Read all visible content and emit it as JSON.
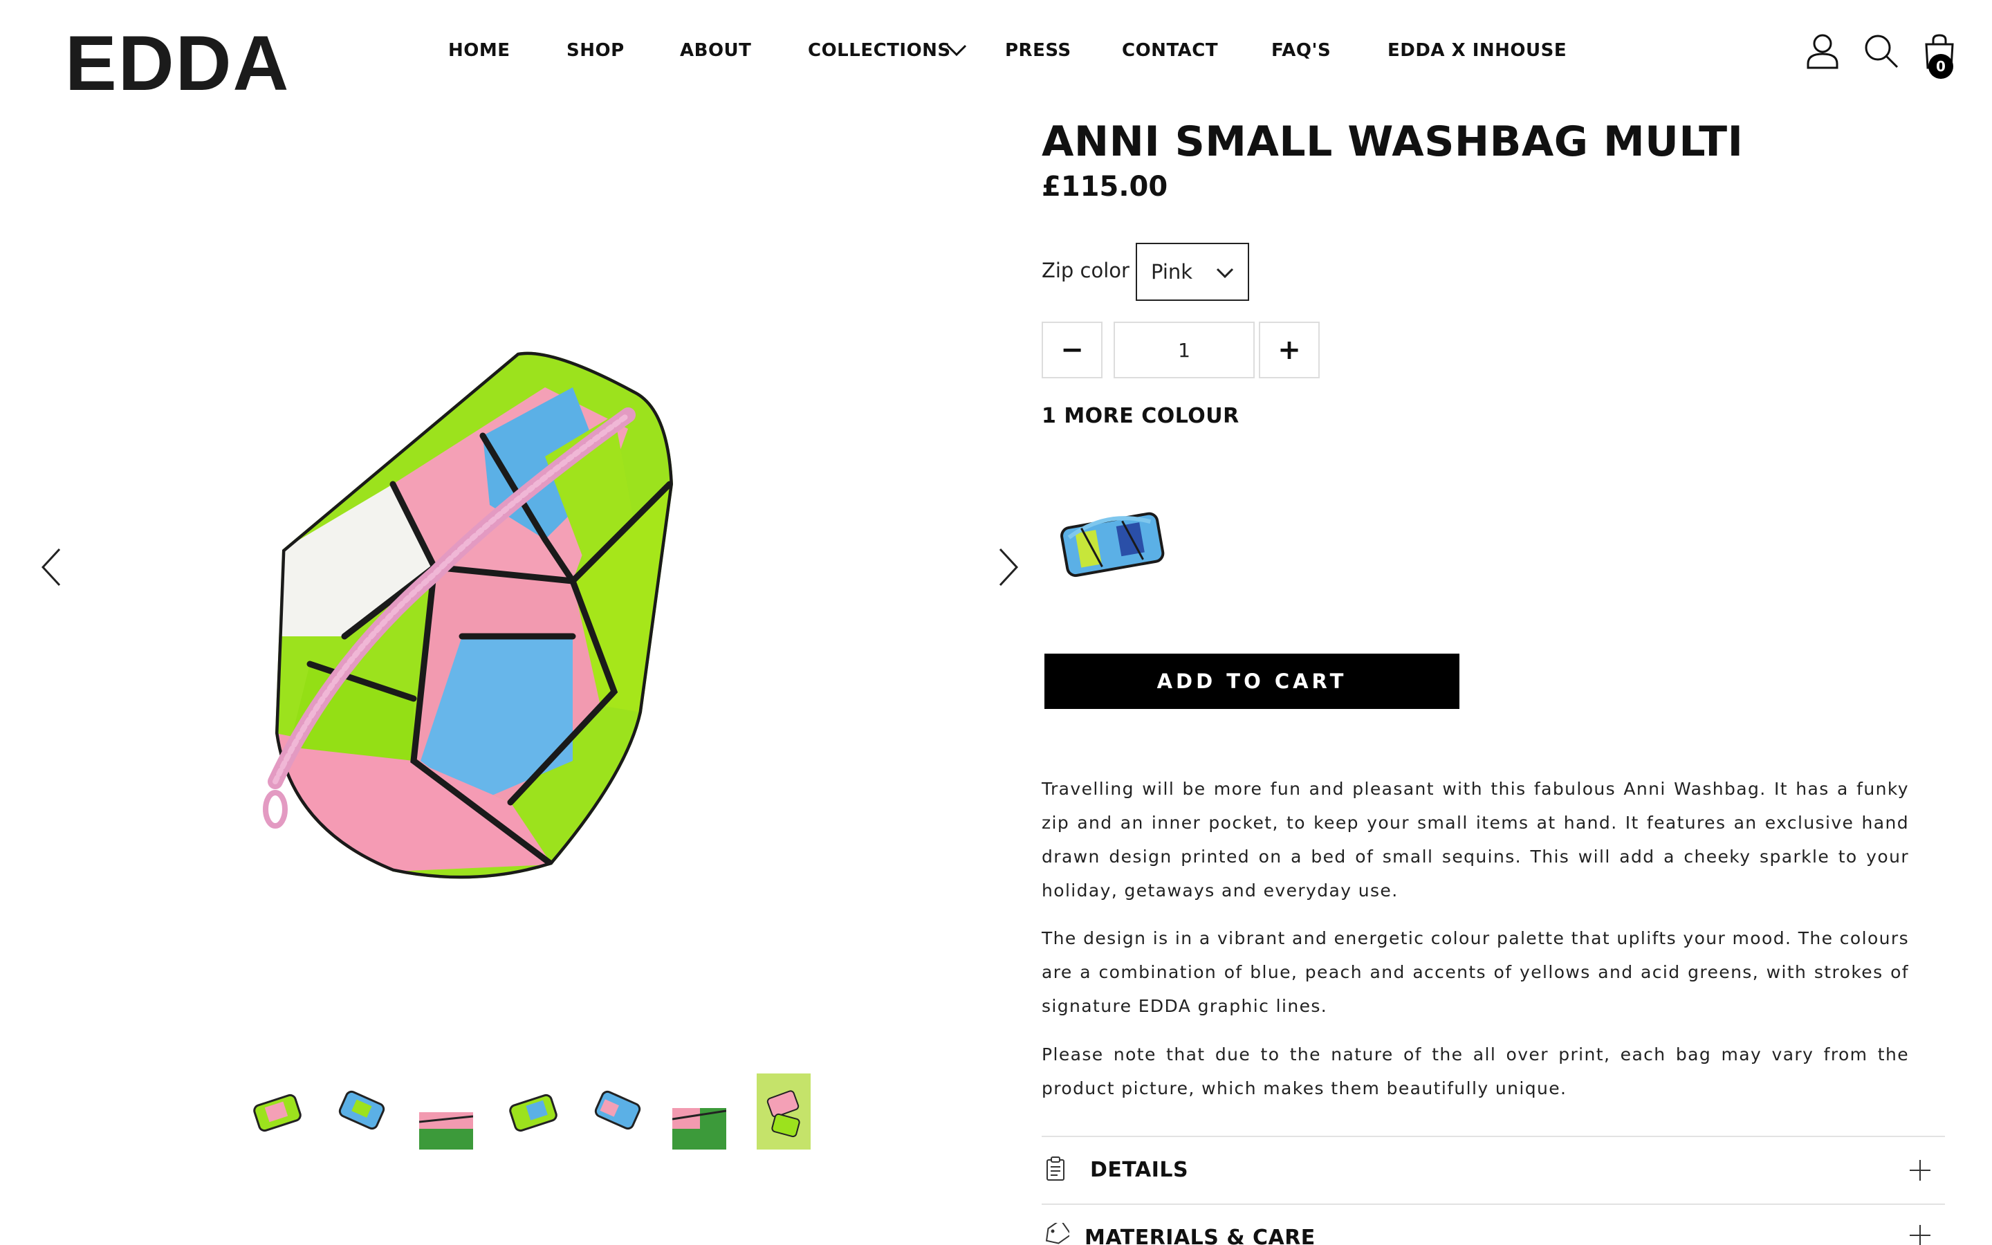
{
  "brand": {
    "logo": "EDDA"
  },
  "nav": {
    "items": [
      {
        "label": "HOME"
      },
      {
        "label": "SHOP"
      },
      {
        "label": "ABOUT"
      },
      {
        "label": "COLLECTIONS"
      },
      {
        "label": "PRESS"
      },
      {
        "label": "CONTACT"
      },
      {
        "label": "FAQ'S"
      },
      {
        "label": "EDDA X INHOUSE"
      }
    ]
  },
  "header": {
    "cart_count": "0",
    "icons": [
      "account-icon",
      "search-icon",
      "shopping-bag-icon"
    ]
  },
  "gallery": {
    "main_image": "multicolour sequin washbag with pink zip",
    "thumbnail_count": 7
  },
  "product": {
    "title": "ANNI SMALL WASHBAG MULTI",
    "price": "£115.00",
    "option": {
      "label": "Zip color",
      "selected": "Pink"
    },
    "quantity": {
      "value": "1",
      "minus": "−",
      "plus": "+"
    },
    "more_colour": "1 MORE COLOUR",
    "add_to_cart": "ADD TO CART",
    "description": [
      "Travelling will be more fun and pleasant with this fabulous Anni Washbag. It has a funky zip and an inner pocket, to keep your small items at hand. It features an exclusive hand drawn design printed on a bed of small sequins. This will add a cheeky sparkle to your holiday, getaways and everyday use.",
      "The design is in a vibrant and energetic colour palette that uplifts your mood. The colours are a combination of blue, peach and accents of yellows and acid greens, with strokes of signature EDDA graphic lines.",
      "Please note that due to the nature of the all over print, each bag may vary from the product picture, which makes them beautifully unique."
    ],
    "accordion": [
      {
        "label": "DETAILS",
        "icon": "clipboard-icon"
      },
      {
        "label": "MATERIALS & CARE",
        "icon": "tag-icon"
      }
    ]
  },
  "colors": {
    "accent": "#000000",
    "text": "#111111",
    "border": "#dddddd"
  }
}
